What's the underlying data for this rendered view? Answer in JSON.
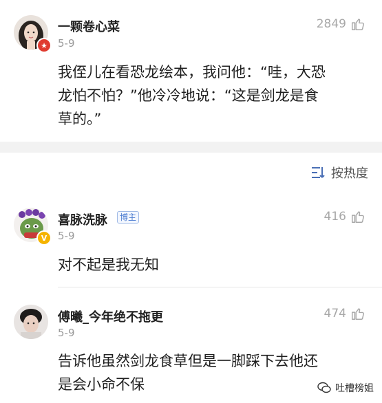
{
  "post": {
    "author": "一颗卷心菜",
    "date": "5-9",
    "likes": "2849",
    "text_line1": "我侄儿在看恐龙绘本，我问他：“哇，大恐",
    "text_line2": "龙怕不怕？”他冷冷地说：“这是剑龙是食",
    "text_line3": "草的。”"
  },
  "sort": {
    "label": "按热度"
  },
  "comments": [
    {
      "author": "喜脉洗脉",
      "tag": "博主",
      "date": "5-9",
      "likes": "416",
      "text_line1": "对不起是我无知"
    },
    {
      "author": "傅曦_今年绝不拖更",
      "date": "5-9",
      "likes": "474",
      "text_line1": "告诉他虽然剑龙食草但是一脚踩下去他还",
      "text_line2": "是会小命不保"
    }
  ],
  "watermark": {
    "label": "吐槽榜姐"
  },
  "colors": {
    "like_gray": "#a8a8a8",
    "tag_blue": "#4a7bd0",
    "divider": "#f2f2f2"
  }
}
